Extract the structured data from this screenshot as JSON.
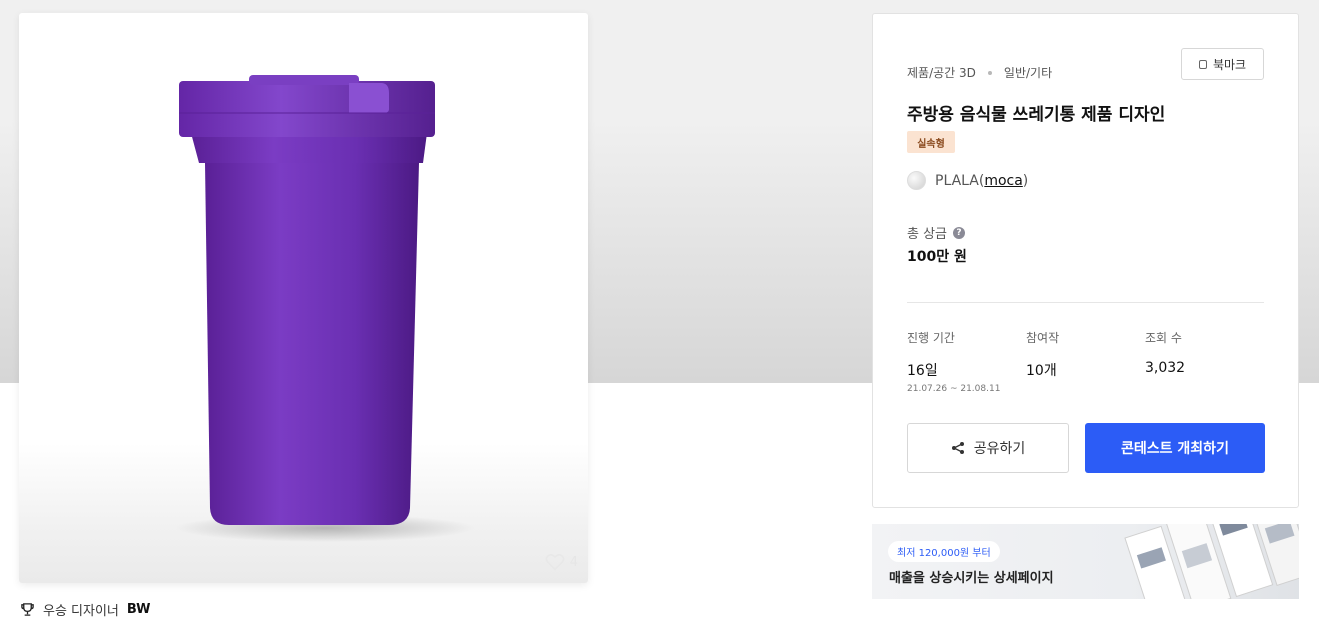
{
  "product": {
    "likes": "4"
  },
  "award": {
    "label": "우승 디자이너",
    "designer": "BW"
  },
  "contest": {
    "category_main": "제품/공간 3D",
    "category_sub": "일반/기타",
    "bookmark_label": "북마크",
    "title": "주방용 음식물 쓰레기통 제품 디자인",
    "badge": "실속형",
    "host_name": "PLALA",
    "host_handle": "moca",
    "prize_label": "총 상금",
    "prize_value": "100만 원",
    "stats": [
      {
        "label": "진행 기간",
        "value": "16일",
        "sub": "21.07.26  ~  21.08.11"
      },
      {
        "label": "참여작",
        "value": "10개",
        "sub": ""
      },
      {
        "label": "조회 수",
        "value": "3,032",
        "sub": ""
      }
    ],
    "share_label": "공유하기",
    "cta_label": "콘테스트 개최하기"
  },
  "banner": {
    "pill": "최저 120,000원 부터",
    "headline": "매출을 상승시키는 상세페이지"
  },
  "colors": {
    "accent": "#2c5cf6",
    "product": "#6b2fb0",
    "badge_bg": "#fbe3d1"
  }
}
